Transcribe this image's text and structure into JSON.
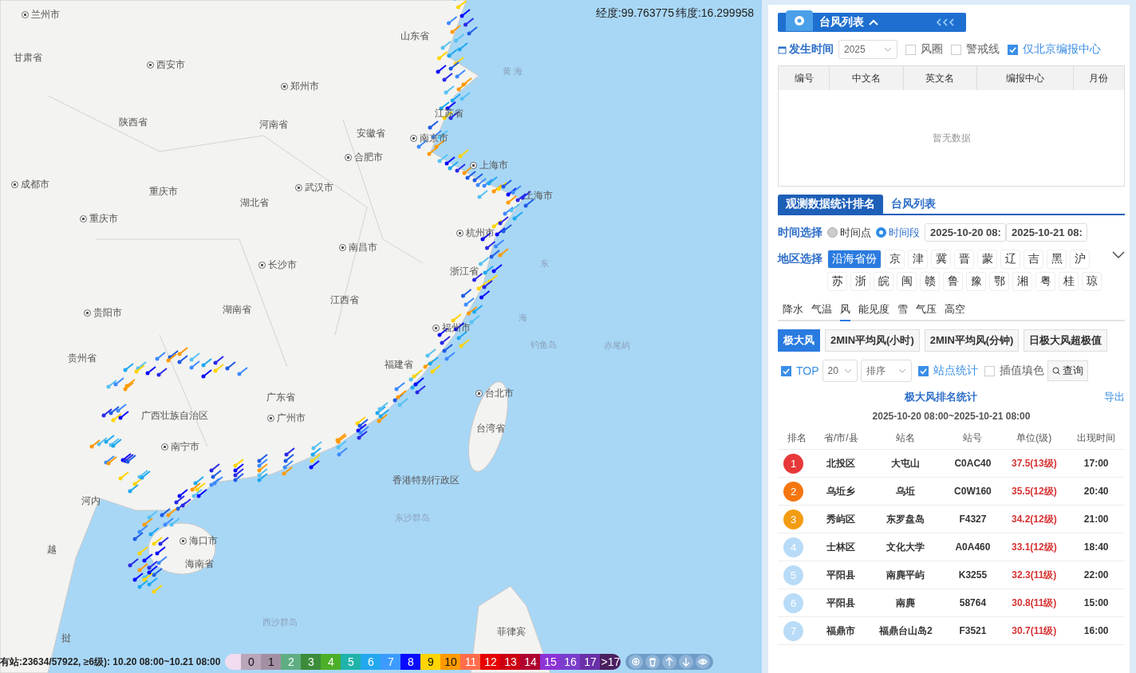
{
  "map": {
    "coordinates": [
      "经度:99.763775",
      "纬度:16.299958"
    ],
    "labels": [
      {
        "text": "兰州市",
        "kind": "city"
      },
      {
        "text": "甘肃省",
        "kind": "province"
      },
      {
        "text": "西安市",
        "kind": "city"
      },
      {
        "text": "山东省",
        "kind": "province"
      },
      {
        "text": "郑州市",
        "kind": "city"
      },
      {
        "text": "陕西省",
        "kind": "province"
      },
      {
        "text": "河南省",
        "kind": "province"
      },
      {
        "text": "安徽省",
        "kind": "province"
      },
      {
        "text": "江苏省",
        "kind": "province"
      },
      {
        "text": "黄 海",
        "kind": "sea"
      },
      {
        "text": "南京市",
        "kind": "city"
      },
      {
        "text": "合肥市",
        "kind": "city"
      },
      {
        "text": "上海市",
        "kind": "city"
      },
      {
        "text": "成都市",
        "kind": "city"
      },
      {
        "text": "重庆市",
        "kind": "province"
      },
      {
        "text": "湖北省",
        "kind": "province"
      },
      {
        "text": "武汉市",
        "kind": "city"
      },
      {
        "text": "上海市",
        "kind": "province"
      },
      {
        "text": "重庆市",
        "kind": "city"
      },
      {
        "text": "杭州市",
        "kind": "city"
      },
      {
        "text": "南昌市",
        "kind": "city"
      },
      {
        "text": "长沙市",
        "kind": "city"
      },
      {
        "text": "浙江省",
        "kind": "province"
      },
      {
        "text": "东",
        "kind": "sea"
      },
      {
        "text": "江西省",
        "kind": "province"
      },
      {
        "text": "湖南省",
        "kind": "province"
      },
      {
        "text": "贵阳市",
        "kind": "city"
      },
      {
        "text": "福州市",
        "kind": "city"
      },
      {
        "text": "海",
        "kind": "sea"
      },
      {
        "text": "钓鱼岛",
        "kind": "sea"
      },
      {
        "text": "赤尾屿",
        "kind": "sea"
      },
      {
        "text": "贵州省",
        "kind": "province"
      },
      {
        "text": "福建省",
        "kind": "province"
      },
      {
        "text": "台北市",
        "kind": "city"
      },
      {
        "text": "广东省",
        "kind": "province"
      },
      {
        "text": "广西壮族自治区",
        "kind": "province"
      },
      {
        "text": "广州市",
        "kind": "city"
      },
      {
        "text": "台湾省",
        "kind": "province"
      },
      {
        "text": "南宁市",
        "kind": "city"
      },
      {
        "text": "香港特别行政区",
        "kind": "province"
      },
      {
        "text": "河内",
        "kind": "province"
      },
      {
        "text": "东沙群岛",
        "kind": "sea"
      },
      {
        "text": "海口市",
        "kind": "city"
      },
      {
        "text": "越",
        "kind": "province"
      },
      {
        "text": "海南省",
        "kind": "province"
      },
      {
        "text": "西沙群岛",
        "kind": "sea"
      },
      {
        "text": "菲律宾",
        "kind": "province"
      },
      {
        "text": "挝",
        "kind": "province"
      }
    ],
    "status": "有站:23634/57922, ≥6级): 10.20 08:00~10.21 08:00",
    "legend": [
      {
        "label": "0",
        "color": "#b9a6b9"
      },
      {
        "label": "1",
        "color": "#a38fa3"
      },
      {
        "label": "2",
        "color": "#5fae82"
      },
      {
        "label": "3",
        "color": "#3c8c3c"
      },
      {
        "label": "4",
        "color": "#4caf28"
      },
      {
        "label": "5",
        "color": "#1fb3aa"
      },
      {
        "label": "6",
        "color": "#23a8ef"
      },
      {
        "label": "7",
        "color": "#3d9bff"
      },
      {
        "label": "8",
        "color": "#0a0aff"
      },
      {
        "label": "9",
        "color": "#ffd400"
      },
      {
        "label": "10",
        "color": "#ff9a00"
      },
      {
        "label": "11",
        "color": "#ff6c4c"
      },
      {
        "label": "12",
        "color": "#e60000"
      },
      {
        "label": "13",
        "color": "#cc0010"
      },
      {
        "label": "14",
        "color": "#b00030"
      },
      {
        "label": "15",
        "color": "#8c33d6"
      },
      {
        "label": "16",
        "color": "#7a3dcc"
      },
      {
        "label": "17",
        "color": "#6a30a8"
      },
      {
        "label": ">17",
        "color": "#4a2060"
      }
    ]
  },
  "panel": {
    "title": "台风列表",
    "filter": {
      "label": "发生时间",
      "year": "2025",
      "checks": [
        {
          "label": "风圈",
          "checked": false
        },
        {
          "label": "警戒线",
          "checked": false
        },
        {
          "label": "仅北京编报中心",
          "checked": true
        }
      ]
    },
    "typhoon_table": {
      "columns": [
        "编号",
        "中文名",
        "英文名",
        "编报中心",
        "月份"
      ],
      "empty_text": "暂无数据"
    },
    "tabs": [
      {
        "label": "观测数据统计排名",
        "selected": true
      },
      {
        "label": "台风列表",
        "selected": false
      }
    ],
    "time": {
      "label": "时间选择",
      "radios": [
        {
          "label": "时间点",
          "selected": false
        },
        {
          "label": "时间段",
          "selected": true
        }
      ],
      "start": "2025-10-20 08:",
      "end": "2025-10-21 08:"
    },
    "region": {
      "label": "地区选择",
      "options": [
        {
          "label": "沿海省份",
          "selected": true
        },
        {
          "label": "京",
          "selected": false
        },
        {
          "label": "津",
          "selected": false
        },
        {
          "label": "冀",
          "selected": false
        },
        {
          "label": "晋",
          "selected": false
        },
        {
          "label": "蒙",
          "selected": false
        },
        {
          "label": "辽",
          "selected": false
        },
        {
          "label": "吉",
          "selected": false
        },
        {
          "label": "黑",
          "selected": false
        },
        {
          "label": "沪",
          "selected": false
        },
        {
          "label": "苏",
          "selected": false
        },
        {
          "label": "浙",
          "selected": false
        },
        {
          "label": "皖",
          "selected": false
        },
        {
          "label": "闽",
          "selected": false
        },
        {
          "label": "赣",
          "selected": false
        },
        {
          "label": "鲁",
          "selected": false
        },
        {
          "label": "豫",
          "selected": false
        },
        {
          "label": "鄂",
          "selected": false
        },
        {
          "label": "湘",
          "selected": false
        },
        {
          "label": "粤",
          "selected": false
        },
        {
          "label": "桂",
          "selected": false
        },
        {
          "label": "琼",
          "selected": false
        }
      ]
    },
    "elements": [
      {
        "label": "降水",
        "selected": false
      },
      {
        "label": "气温",
        "selected": false
      },
      {
        "label": "风",
        "selected": true
      },
      {
        "label": "能见度",
        "selected": false
      },
      {
        "label": "雪",
        "selected": false
      },
      {
        "label": "气压",
        "selected": false
      },
      {
        "label": "高空",
        "selected": false
      }
    ],
    "wind_types": [
      {
        "label": "极大风",
        "selected": true
      },
      {
        "label": "2MIN平均风(小时)",
        "selected": false
      },
      {
        "label": "2MIN平均风(分钟)",
        "selected": false
      },
      {
        "label": "日极大风超极值",
        "selected": false
      }
    ],
    "options": {
      "top": {
        "label": "TOP",
        "checked": true
      },
      "count": "20",
      "sort_placeholder": "排序",
      "station_stats": {
        "label": "站点统计",
        "checked": true
      },
      "fill": {
        "label": "插值填色",
        "checked": false
      },
      "query": "查询"
    },
    "stats": {
      "title": "极大风排名统计",
      "export": "导出",
      "range": "2025-10-20 08:00~2025-10-21 08:00",
      "columns": [
        "排名",
        "省/市/县",
        "站名",
        "站号",
        "单位(级)",
        "出现时间"
      ],
      "rows": [
        {
          "rank": "1",
          "color": "#e8393a",
          "area": "北投区",
          "station": "大屯山",
          "id": "C0AC40",
          "value": "37.5(13级)",
          "time": "17:00"
        },
        {
          "rank": "2",
          "color": "#f5760f",
          "area": "乌坵乡",
          "station": "乌坵",
          "id": "C0W160",
          "value": "35.5(12级)",
          "time": "20:40"
        },
        {
          "rank": "3",
          "color": "#f39c12",
          "area": "秀屿区",
          "station": "东罗盘岛",
          "id": "F4327",
          "value": "34.2(12级)",
          "time": "21:00"
        },
        {
          "rank": "4",
          "color": "#b8dbf7",
          "area": "士林区",
          "station": "文化大学",
          "id": "A0A460",
          "value": "33.1(12级)",
          "time": "18:40"
        },
        {
          "rank": "5",
          "color": "#b8dbf7",
          "area": "平阳县",
          "station": "南麂平屿",
          "id": "K3255",
          "value": "32.3(11级)",
          "time": "22:00"
        },
        {
          "rank": "6",
          "color": "#b8dbf7",
          "area": "平阳县",
          "station": "南麂",
          "id": "58764",
          "value": "30.8(11级)",
          "time": "15:00"
        },
        {
          "rank": "7",
          "color": "#b8dbf7",
          "area": "福鼎市",
          "station": "福鼎台山岛2",
          "id": "F3521",
          "value": "30.7(11级)",
          "time": "16:00"
        }
      ]
    }
  }
}
